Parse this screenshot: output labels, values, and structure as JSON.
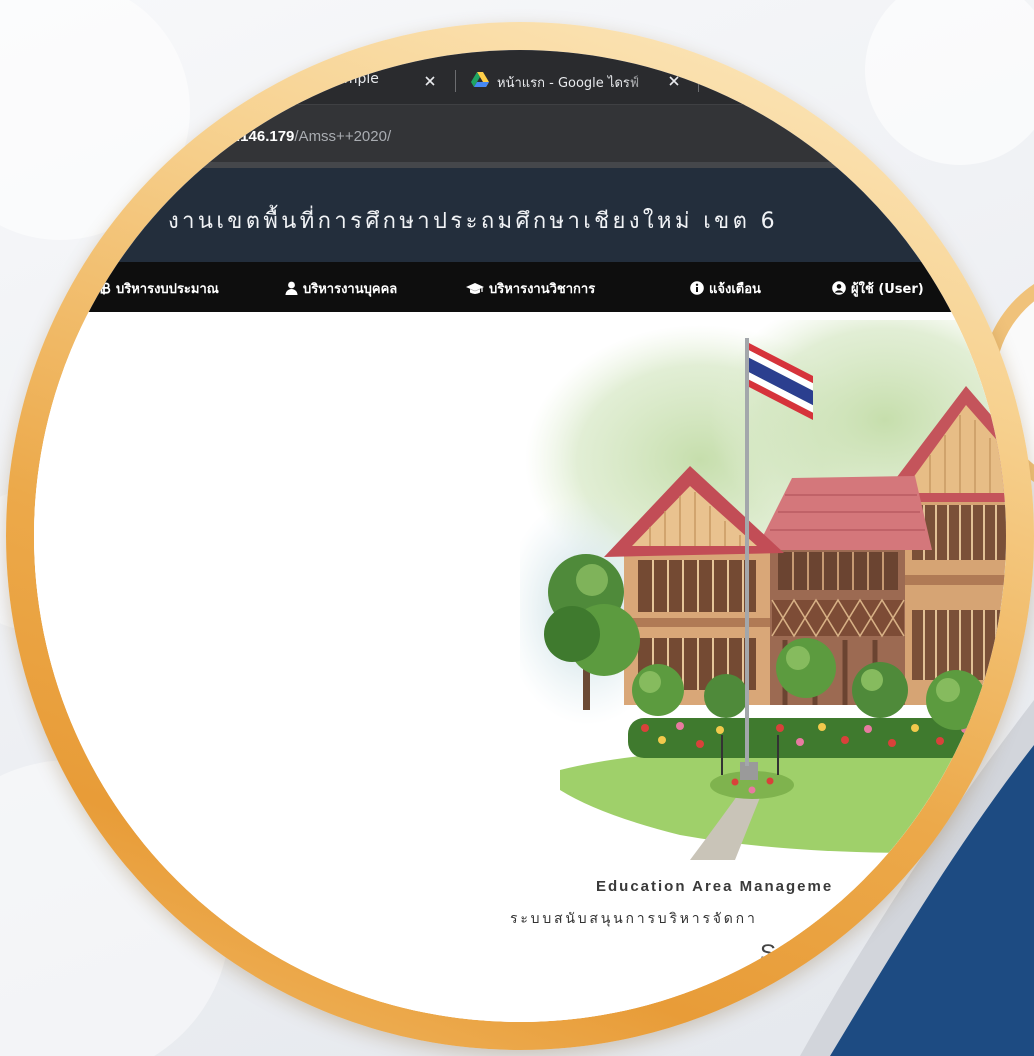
{
  "browser": {
    "tabs": [
      {
        "label": "imple",
        "close_icon": "close-icon"
      },
      {
        "label": "หน้าแรก - Google ไดรฟ์",
        "favicon": "google-drive-icon",
        "close_icon": "close-icon"
      }
    ],
    "address": {
      "host": ".146.179",
      "path": "/Amss++2020/"
    }
  },
  "site": {
    "header_title": "งานเขตพื้นที่การศึกษาประถมศึกษาเชียงใหม่ เขต 6",
    "nav": [
      {
        "label": "บริหารงบประมาณ",
        "icon": "baht-icon"
      },
      {
        "label": "บริหารงานบุคคล",
        "icon": "user-icon"
      },
      {
        "label": "บริหารงานวิชาการ",
        "icon": "graduation-cap-icon"
      },
      {
        "label": "แจ้งเตือน",
        "icon": "info-circle-icon"
      },
      {
        "label": "ผู้ใช้ (User)",
        "icon": "user-circle-icon"
      }
    ],
    "hero_image": "school-building-illustration",
    "caption": {
      "english": "Education Area Manageme",
      "thai": "ระบบสนับสนุนการบริหารจัดกา",
      "partial": "S"
    }
  },
  "colors": {
    "ring_gold": "#eca94a",
    "ring_cream": "#fdebc4",
    "header_navy": "#232e3c",
    "nav_black": "#0e0e0e",
    "accent_blue": "#1d4b82",
    "flag_red": "#d6333b",
    "flag_white": "#ffffff",
    "flag_blue": "#2b3f8f"
  }
}
